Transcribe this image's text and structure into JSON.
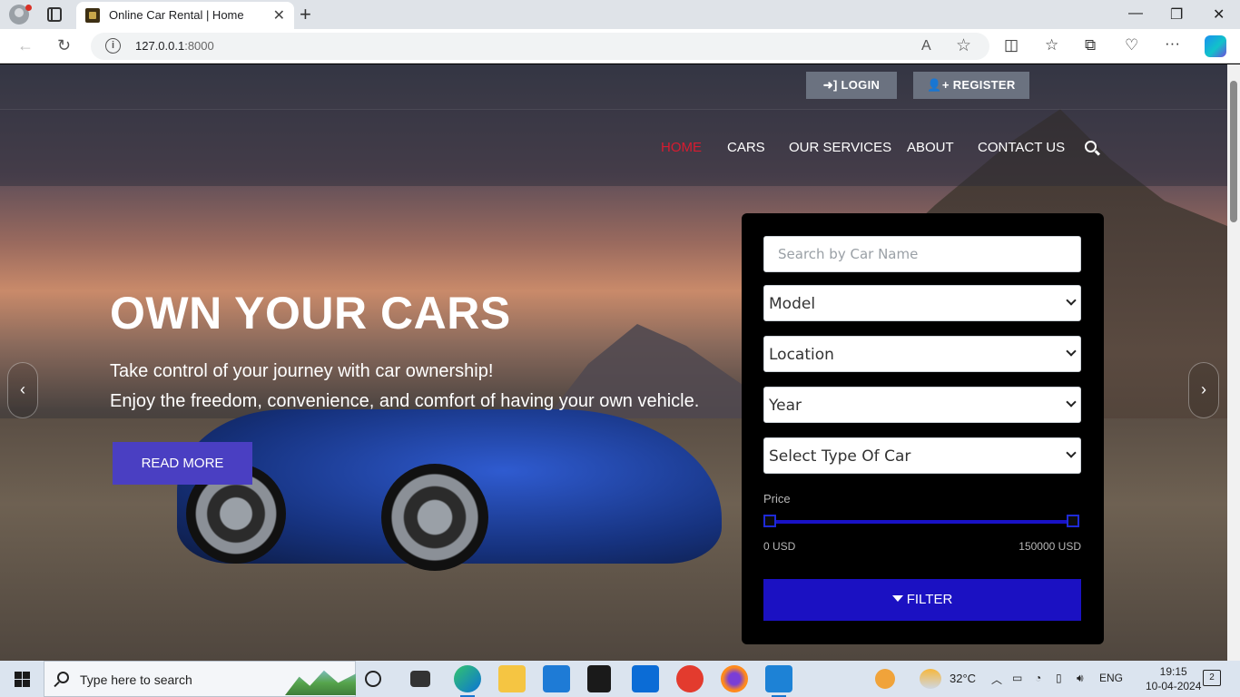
{
  "browser": {
    "tab_title": "Online Car Rental | Home",
    "tab_close": "✕",
    "new_tab": "+",
    "url_host": "127.0.0.1",
    "url_port": ":8000",
    "window_controls": {
      "minimize": "—",
      "restore": "❐",
      "close": "✕"
    },
    "nav_icons": {
      "back": "←",
      "refresh": "↻"
    },
    "address_icons": {
      "read_aloud": "A",
      "favorite": "☆"
    },
    "toolbar_icons": {
      "split": "◫",
      "favorites": "☆",
      "collections": "⧉",
      "health": "♡",
      "more": "···"
    }
  },
  "site": {
    "auth": {
      "login": "LOGIN",
      "register": "REGISTER"
    },
    "menu": [
      "HOME",
      "CARS",
      "OUR SERVICES",
      "ABOUT",
      "CONTACT US"
    ],
    "active_menu": "HOME",
    "hero": {
      "title": "OWN YOUR CARS",
      "line1": "Take control of your journey with car ownership!",
      "line2": "Enjoy the freedom, convenience, and comfort of having your own vehicle.",
      "cta": "READ MORE"
    },
    "carousel": {
      "prev": "‹",
      "next": "›"
    },
    "filter": {
      "search_placeholder": "Search by Car Name",
      "selects": [
        "Model",
        "Location",
        "Year",
        "Select Type Of Car"
      ],
      "price_label": "Price",
      "price_min": "0 USD",
      "price_max": "150000 USD",
      "button": "FILTER"
    }
  },
  "taskbar": {
    "search_placeholder": "Type here to search",
    "weather": "32°C",
    "language": "ENG",
    "time": "19:15",
    "date": "10-04-2024",
    "notifications": "2"
  },
  "colors": {
    "accent_active": "#d81b30",
    "read_more_bg": "#4a3fc2",
    "filter_button_bg": "#1b11c2",
    "slider": "#1912c6"
  }
}
